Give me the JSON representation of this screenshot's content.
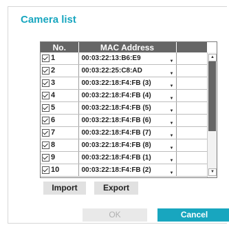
{
  "dialog": {
    "title": "Camera list"
  },
  "table": {
    "headers": {
      "no": "No.",
      "mac": "MAC Address"
    },
    "rows": [
      {
        "no": "1",
        "mac": "00:03:22:13:B6:E9",
        "checked": true
      },
      {
        "no": "2",
        "mac": "00:03:22:25:C8:AD",
        "checked": true
      },
      {
        "no": "3",
        "mac": "00:03:22:18:F4:FB (3)",
        "checked": true
      },
      {
        "no": "4",
        "mac": "00:03:22:18:F4:FB (4)",
        "checked": true
      },
      {
        "no": "5",
        "mac": "00:03:22:18:F4:FB (5)",
        "checked": true
      },
      {
        "no": "6",
        "mac": "00:03:22:18:F4:FB (6)",
        "checked": true
      },
      {
        "no": "7",
        "mac": "00:03:22:18:F4:FB (7)",
        "checked": true
      },
      {
        "no": "8",
        "mac": "00:03:22:18:F4:FB (8)",
        "checked": true
      },
      {
        "no": "9",
        "mac": "00:03:22:18:F4:FB (1)",
        "checked": true
      },
      {
        "no": "10",
        "mac": "00:03:22:18:F4:FB (2)",
        "checked": true
      }
    ]
  },
  "buttons": {
    "import": "Import",
    "export": "Export",
    "ok": "OK",
    "cancel": "Cancel"
  },
  "icons": {
    "checkbox": "checkbox-checked-icon",
    "dropdown": "caret-down-icon",
    "scroll_up": "arrow-up-icon",
    "scroll_down": "arrow-down-icon"
  },
  "colors": {
    "accent": "#18a6bf",
    "header_bg": "#666666",
    "disabled_text": "#b0b0b0"
  }
}
